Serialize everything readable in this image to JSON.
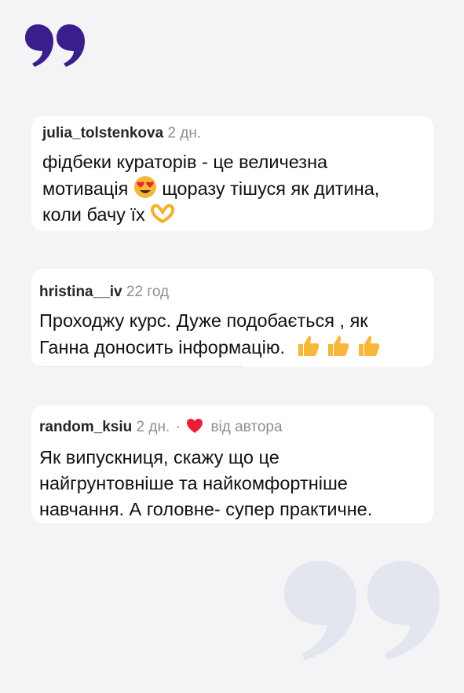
{
  "colors": {
    "background": "#f4f4f6",
    "quote_accent": "#3a1e8c",
    "quote_watermark": "#e3e6ee",
    "heart": "#ed1d3a"
  },
  "comments": [
    {
      "username": "julia_tolstenkova",
      "time": "2 дн.",
      "line1": "фідбеки кураторів - це величезна",
      "line2a": "мотивація",
      "emoji2": "heart-eyes-face-emoji",
      "line2b": "щоразу тішуся як дитина,",
      "line3": "коли бачу їх",
      "emoji3": "heart-hands-emoji"
    },
    {
      "username": "hristina__iv",
      "time": "22 год",
      "line1": "Проходжу курс. Дуже подобається , як",
      "line2": "Ганна доносить інформацію.",
      "emoji": "thumbs-up-emoji"
    },
    {
      "username": "random_ksiu",
      "time": "2 дн.",
      "separator": "·",
      "liked_label": "від автора",
      "line1": "Як випускниця, скажу  що це",
      "line2": "найгрунтовніше та найкомфортніше",
      "line3": "навчання. А головне- супер практичне."
    }
  ]
}
